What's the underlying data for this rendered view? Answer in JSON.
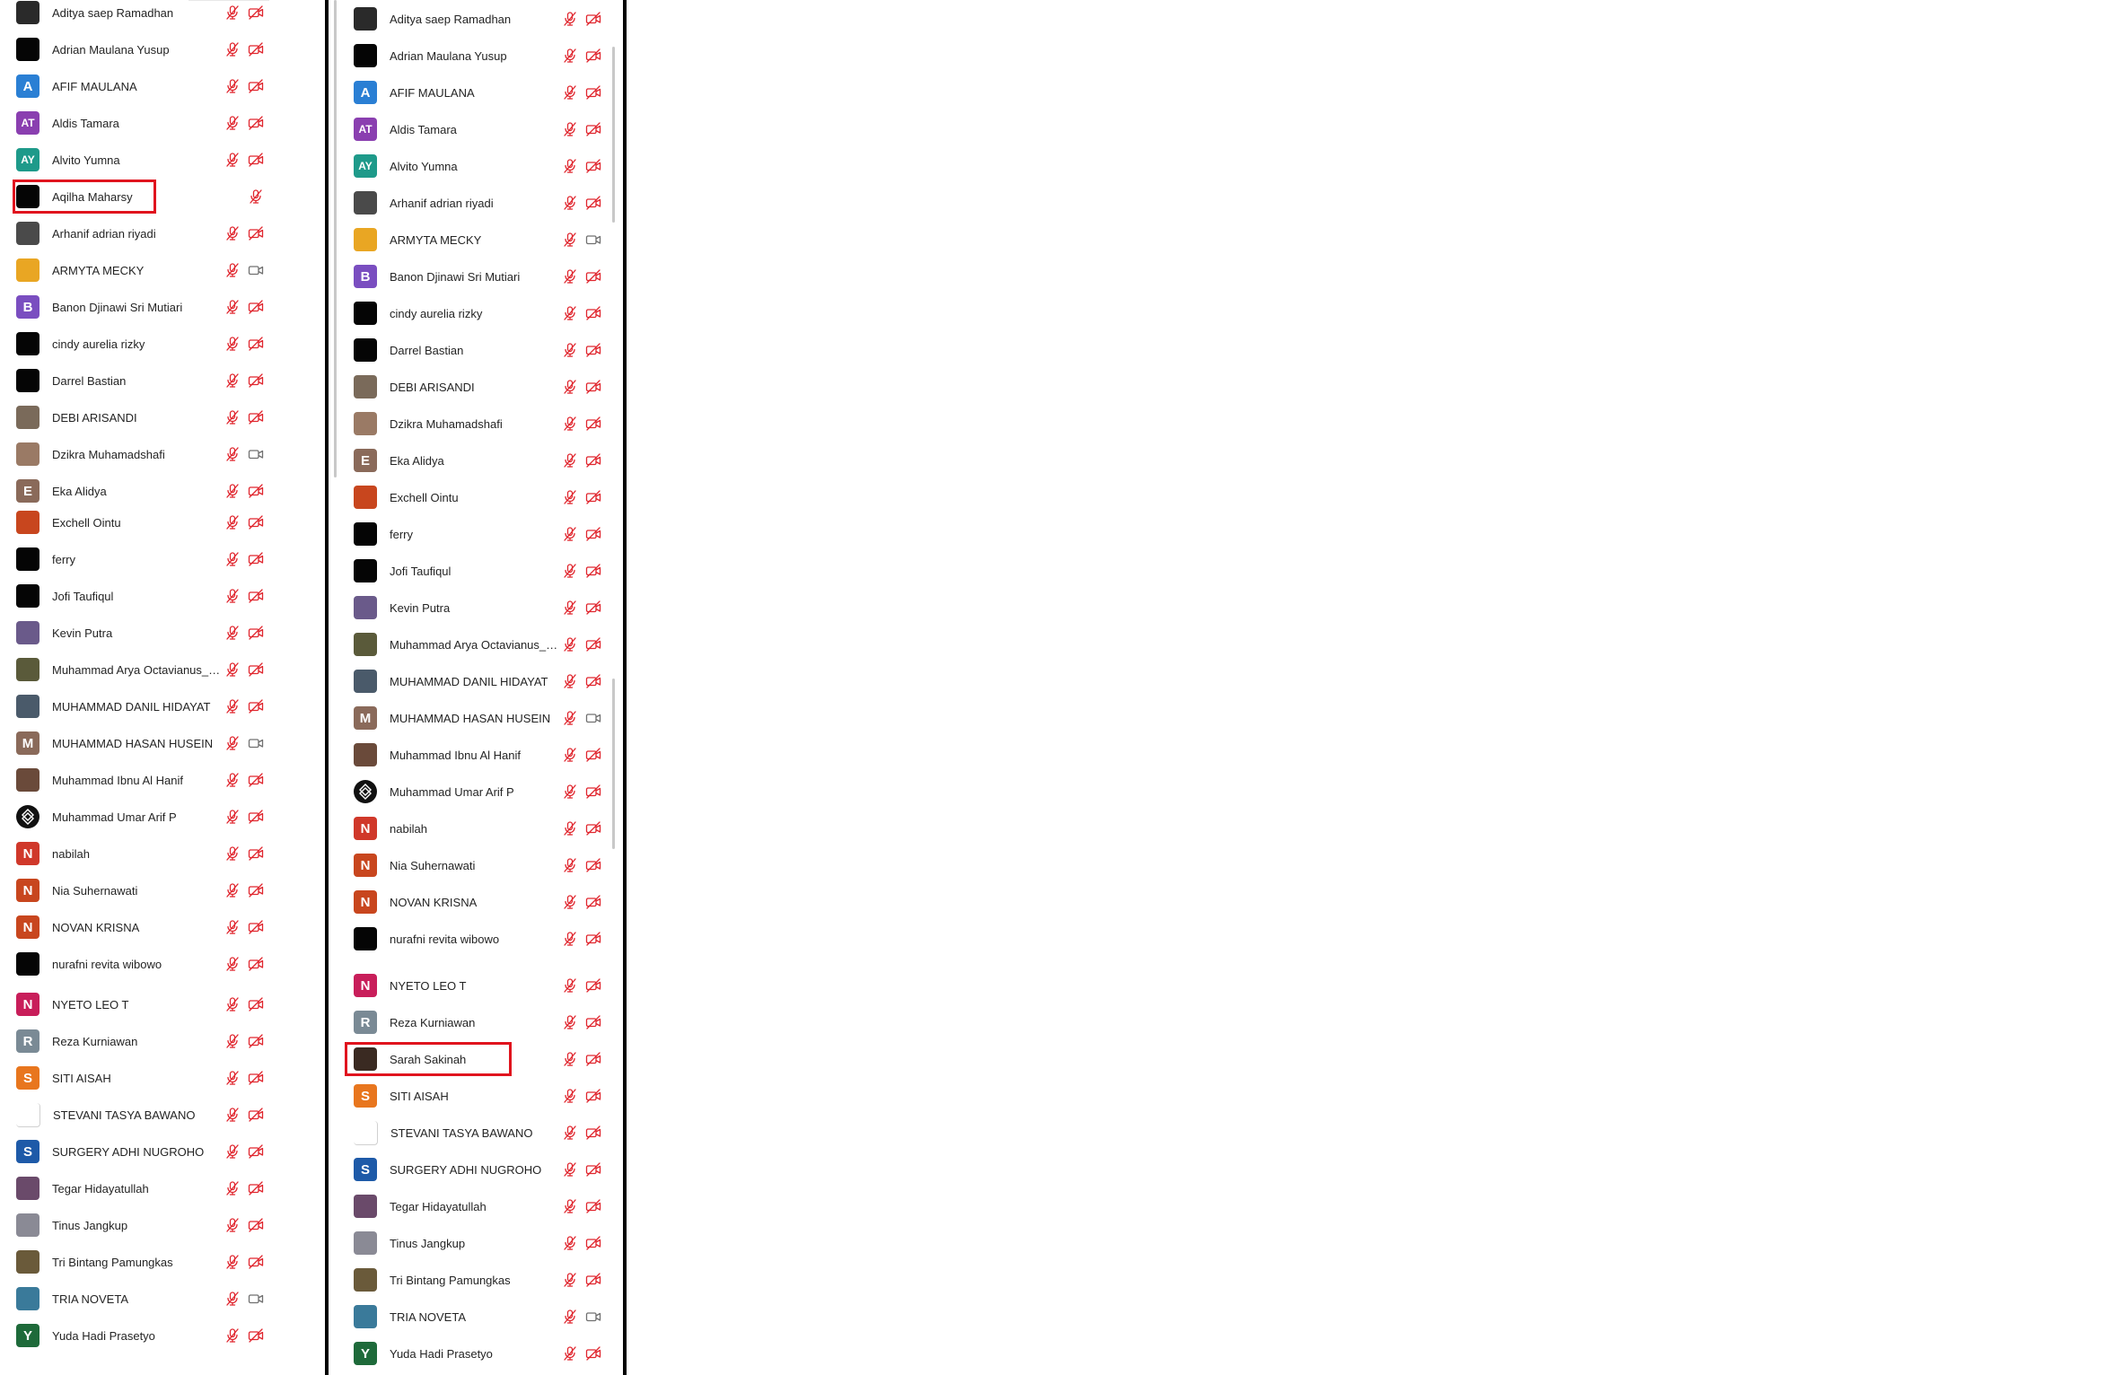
{
  "colors": {
    "muted_icon": "#e0262e",
    "video_icon": "#707070",
    "highlight": "#e0141e"
  },
  "left_panel": {
    "participants": [
      {
        "name": "Aditya saep Ramadhan",
        "avatar": {
          "type": "photo",
          "color": "#2a2a2a"
        },
        "mic": "mic-muted-icon",
        "video": "video-off-icon"
      },
      {
        "name": "Adrian Maulana Yusup",
        "avatar": {
          "type": "photo",
          "color": "#050505"
        },
        "mic": "mic-muted-icon",
        "video": "video-off-icon"
      },
      {
        "name": "AFIF MAULANA",
        "avatar": {
          "type": "initials",
          "initials": "A",
          "color": "#2a7fd4"
        },
        "mic": "mic-muted-icon",
        "video": "video-off-icon"
      },
      {
        "name": "Aldis Tamara",
        "avatar": {
          "type": "initials",
          "initials": "AT",
          "color": "#8a3fb0"
        },
        "mic": "mic-muted-icon",
        "video": "video-off-icon"
      },
      {
        "name": "Alvito Yumna",
        "avatar": {
          "type": "initials",
          "initials": "AY",
          "color": "#1e9a8a"
        },
        "mic": "mic-muted-icon",
        "video": "video-off-icon"
      },
      {
        "name": "Aqilha Maharsy",
        "avatar": {
          "type": "photo",
          "color": "#050505"
        },
        "mic": "mic-muted-icon",
        "video": "",
        "highlighted": true
      },
      {
        "name": "Arhanif adrian riyadi",
        "avatar": {
          "type": "photo",
          "color": "#4a4a4a"
        },
        "mic": "mic-muted-icon",
        "video": "video-off-icon"
      },
      {
        "name": "ARMYTA MECKY",
        "avatar": {
          "type": "photo",
          "color": "#e9a623"
        },
        "mic": "mic-muted-icon",
        "video": "video-on-icon"
      },
      {
        "name": "Banon Djinawi Sri Mutiari",
        "avatar": {
          "type": "initials",
          "initials": "B",
          "color": "#7a4ec0"
        },
        "mic": "mic-muted-icon",
        "video": "video-off-icon"
      },
      {
        "name": "cindy aurelia rizky",
        "avatar": {
          "type": "photo",
          "color": "#050505"
        },
        "mic": "mic-muted-icon",
        "video": "video-off-icon"
      },
      {
        "name": "Darrel Bastian",
        "avatar": {
          "type": "photo",
          "color": "#050505"
        },
        "mic": "mic-muted-icon",
        "video": "video-off-icon"
      },
      {
        "name": "DEBI ARISANDI",
        "avatar": {
          "type": "photo",
          "color": "#7a6a5a"
        },
        "mic": "mic-muted-icon",
        "video": "video-off-icon"
      },
      {
        "name": "Dzikra Muhamadshafi",
        "avatar": {
          "type": "photo",
          "color": "#9a7a65"
        },
        "mic": "mic-muted-icon",
        "video": "video-on-icon"
      },
      {
        "name": "Eka Alidya",
        "avatar": {
          "type": "initials",
          "initials": "E",
          "color": "#8a6a5a"
        },
        "mic": "mic-muted-icon",
        "video": "video-off-icon"
      },
      {
        "name": "Exchell Ointu",
        "avatar": {
          "type": "photo",
          "color": "#c8461e"
        },
        "mic": "mic-muted-icon",
        "video": "video-off-icon"
      },
      {
        "name": "ferry",
        "avatar": {
          "type": "photo",
          "color": "#050505"
        },
        "mic": "mic-muted-icon",
        "video": "video-off-icon"
      },
      {
        "name": "Jofi Taufiqul",
        "avatar": {
          "type": "photo",
          "color": "#050505"
        },
        "mic": "mic-muted-icon",
        "video": "video-off-icon"
      },
      {
        "name": "Kevin Putra",
        "avatar": {
          "type": "photo",
          "color": "#6a5a8a"
        },
        "mic": "mic-muted-icon",
        "video": "video-off-icon"
      },
      {
        "name": "Muhammad Arya Octavianus_J...",
        "avatar": {
          "type": "photo",
          "color": "#5a5a3a"
        },
        "mic": "mic-muted-icon",
        "video": "video-off-icon"
      },
      {
        "name": "MUHAMMAD DANIL HIDAYAT",
        "avatar": {
          "type": "photo",
          "color": "#4a5a6a"
        },
        "mic": "mic-muted-icon",
        "video": "video-off-icon"
      },
      {
        "name": "MUHAMMAD HASAN HUSEIN",
        "avatar": {
          "type": "initials",
          "initials": "M",
          "color": "#8a6a5a"
        },
        "mic": "mic-muted-icon",
        "video": "video-on-icon"
      },
      {
        "name": "Muhammad Ibnu Al Hanif",
        "avatar": {
          "type": "photo",
          "color": "#6a4a3a"
        },
        "mic": "mic-muted-icon",
        "video": "video-off-icon"
      },
      {
        "name": "Muhammad Umar Arif P",
        "avatar": {
          "type": "logo",
          "color": "#111111"
        },
        "mic": "mic-muted-icon",
        "video": "video-off-icon"
      },
      {
        "name": "nabilah",
        "avatar": {
          "type": "initials",
          "initials": "N",
          "color": "#d0382a"
        },
        "mic": "mic-muted-icon",
        "video": "video-off-icon"
      },
      {
        "name": "Nia Suhernawati",
        "avatar": {
          "type": "initials",
          "initials": "N",
          "color": "#c8461e"
        },
        "mic": "mic-muted-icon",
        "video": "video-off-icon"
      },
      {
        "name": "NOVAN KRISNA",
        "avatar": {
          "type": "initials",
          "initials": "N",
          "color": "#c8461e"
        },
        "mic": "mic-muted-icon",
        "video": "video-off-icon"
      },
      {
        "name": "nurafni revita wibowo",
        "avatar": {
          "type": "photo",
          "color": "#050505"
        },
        "mic": "mic-muted-icon",
        "video": "video-off-icon"
      },
      {
        "name": "NYETO LEO T",
        "avatar": {
          "type": "initials",
          "initials": "N",
          "color": "#c81e5a"
        },
        "mic": "mic-muted-icon",
        "video": "video-off-icon"
      },
      {
        "name": "Reza Kurniawan",
        "avatar": {
          "type": "initials",
          "initials": "R",
          "color": "#7a8a95"
        },
        "mic": "mic-muted-icon",
        "video": "video-off-icon"
      },
      {
        "name": "SITI AISAH",
        "avatar": {
          "type": "initials",
          "initials": "S",
          "color": "#e8761e"
        },
        "mic": "mic-muted-icon",
        "video": "video-off-icon"
      },
      {
        "name": "STEVANI TASYA BAWANO",
        "avatar": {
          "type": "blank",
          "color": "#ffffff"
        },
        "mic": "mic-muted-icon",
        "video": "video-off-icon"
      },
      {
        "name": "SURGERY ADHI NUGROHO",
        "avatar": {
          "type": "initials",
          "initials": "S",
          "color": "#1e5aa8"
        },
        "mic": "mic-muted-icon",
        "video": "video-off-icon"
      },
      {
        "name": "Tegar Hidayatullah",
        "avatar": {
          "type": "photo",
          "color": "#6a4a6a"
        },
        "mic": "mic-muted-icon",
        "video": "video-off-icon"
      },
      {
        "name": "Tinus Jangkup",
        "avatar": {
          "type": "photo",
          "color": "#8a8a95"
        },
        "mic": "mic-muted-icon",
        "video": "video-off-icon"
      },
      {
        "name": "Tri Bintang Pamungkas",
        "avatar": {
          "type": "photo",
          "color": "#6a5a3a"
        },
        "mic": "mic-muted-icon",
        "video": "video-off-icon"
      },
      {
        "name": "TRIA NOVETA",
        "avatar": {
          "type": "photo",
          "color": "#3a7a9a"
        },
        "mic": "mic-muted-icon",
        "video": "video-on-icon"
      },
      {
        "name": "Yuda Hadi Prasetyo",
        "avatar": {
          "type": "initials",
          "initials": "Y",
          "color": "#1e6a3a"
        },
        "mic": "mic-muted-icon",
        "video": "video-off-icon"
      }
    ]
  },
  "right_panel": {
    "participants": [
      {
        "name": "Aditya saep Ramadhan",
        "avatar": {
          "type": "photo",
          "color": "#2a2a2a"
        },
        "mic": "mic-muted-icon",
        "video": "video-off-icon"
      },
      {
        "name": "Adrian Maulana Yusup",
        "avatar": {
          "type": "photo",
          "color": "#050505"
        },
        "mic": "mic-muted-icon",
        "video": "video-off-icon"
      },
      {
        "name": "AFIF MAULANA",
        "avatar": {
          "type": "initials",
          "initials": "A",
          "color": "#2a7fd4"
        },
        "mic": "mic-muted-icon",
        "video": "video-off-icon"
      },
      {
        "name": "Aldis Tamara",
        "avatar": {
          "type": "initials",
          "initials": "AT",
          "color": "#8a3fb0"
        },
        "mic": "mic-muted-icon",
        "video": "video-off-icon"
      },
      {
        "name": "Alvito Yumna",
        "avatar": {
          "type": "initials",
          "initials": "AY",
          "color": "#1e9a8a"
        },
        "mic": "mic-muted-icon",
        "video": "video-off-icon"
      },
      {
        "name": "Arhanif adrian riyadi",
        "avatar": {
          "type": "photo",
          "color": "#4a4a4a"
        },
        "mic": "mic-muted-icon",
        "video": "video-off-icon"
      },
      {
        "name": "ARMYTA MECKY",
        "avatar": {
          "type": "photo",
          "color": "#e9a623"
        },
        "mic": "mic-muted-icon",
        "video": "video-on-icon"
      },
      {
        "name": "Banon Djinawi Sri Mutiari",
        "avatar": {
          "type": "initials",
          "initials": "B",
          "color": "#7a4ec0"
        },
        "mic": "mic-muted-icon",
        "video": "video-off-icon"
      },
      {
        "name": "cindy aurelia rizky",
        "avatar": {
          "type": "photo",
          "color": "#050505"
        },
        "mic": "mic-muted-icon",
        "video": "video-off-icon"
      },
      {
        "name": "Darrel Bastian",
        "avatar": {
          "type": "photo",
          "color": "#050505"
        },
        "mic": "mic-muted-icon",
        "video": "video-off-icon"
      },
      {
        "name": "DEBI ARISANDI",
        "avatar": {
          "type": "photo",
          "color": "#7a6a5a"
        },
        "mic": "mic-muted-icon",
        "video": "video-off-icon"
      },
      {
        "name": "Dzikra Muhamadshafi",
        "avatar": {
          "type": "photo",
          "color": "#9a7a65"
        },
        "mic": "mic-muted-icon",
        "video": "video-off-icon"
      },
      {
        "name": "Eka Alidya",
        "avatar": {
          "type": "initials",
          "initials": "E",
          "color": "#8a6a5a"
        },
        "mic": "mic-muted-icon",
        "video": "video-off-icon"
      },
      {
        "name": "Exchell Ointu",
        "avatar": {
          "type": "photo",
          "color": "#c8461e"
        },
        "mic": "mic-muted-icon",
        "video": "video-off-icon"
      },
      {
        "name": "ferry",
        "avatar": {
          "type": "photo",
          "color": "#050505"
        },
        "mic": "mic-muted-icon",
        "video": "video-off-icon"
      },
      {
        "name": "Jofi Taufiqul",
        "avatar": {
          "type": "photo",
          "color": "#050505"
        },
        "mic": "mic-muted-icon",
        "video": "video-off-icon"
      },
      {
        "name": "Kevin Putra",
        "avatar": {
          "type": "photo",
          "color": "#6a5a8a"
        },
        "mic": "mic-muted-icon",
        "video": "video-off-icon"
      },
      {
        "name": "Muhammad Arya Octavianus_J...",
        "avatar": {
          "type": "photo",
          "color": "#5a5a3a"
        },
        "mic": "mic-muted-icon",
        "video": "video-off-icon"
      },
      {
        "name": "MUHAMMAD DANIL HIDAYAT",
        "avatar": {
          "type": "photo",
          "color": "#4a5a6a"
        },
        "mic": "mic-muted-icon",
        "video": "video-off-icon"
      },
      {
        "name": "MUHAMMAD HASAN HUSEIN",
        "avatar": {
          "type": "initials",
          "initials": "M",
          "color": "#8a6a5a"
        },
        "mic": "mic-muted-icon",
        "video": "video-on-icon"
      },
      {
        "name": "Muhammad Ibnu Al Hanif",
        "avatar": {
          "type": "photo",
          "color": "#6a4a3a"
        },
        "mic": "mic-muted-icon",
        "video": "video-off-icon"
      },
      {
        "name": "Muhammad Umar Arif P",
        "avatar": {
          "type": "logo",
          "color": "#111111"
        },
        "mic": "mic-muted-icon",
        "video": "video-off-icon"
      },
      {
        "name": "nabilah",
        "avatar": {
          "type": "initials",
          "initials": "N",
          "color": "#d0382a"
        },
        "mic": "mic-muted-icon",
        "video": "video-off-icon"
      },
      {
        "name": "Nia Suhernawati",
        "avatar": {
          "type": "initials",
          "initials": "N",
          "color": "#c8461e"
        },
        "mic": "mic-muted-icon",
        "video": "video-off-icon"
      },
      {
        "name": "NOVAN KRISNA",
        "avatar": {
          "type": "initials",
          "initials": "N",
          "color": "#c8461e"
        },
        "mic": "mic-muted-icon",
        "video": "video-off-icon"
      },
      {
        "name": "nurafni revita wibowo",
        "avatar": {
          "type": "photo",
          "color": "#050505"
        },
        "mic": "mic-muted-icon",
        "video": "video-off-icon"
      },
      {
        "name": "NYETO LEO T",
        "avatar": {
          "type": "initials",
          "initials": "N",
          "color": "#c81e5a"
        },
        "mic": "mic-muted-icon",
        "video": "video-off-icon"
      },
      {
        "name": "Reza Kurniawan",
        "avatar": {
          "type": "initials",
          "initials": "R",
          "color": "#7a8a95"
        },
        "mic": "mic-muted-icon",
        "video": "video-off-icon"
      },
      {
        "name": "Sarah Sakinah",
        "avatar": {
          "type": "photo",
          "color": "#3a2a22"
        },
        "mic": "mic-muted-icon",
        "video": "video-off-icon",
        "highlighted": true
      },
      {
        "name": "SITI AISAH",
        "avatar": {
          "type": "initials",
          "initials": "S",
          "color": "#e8761e"
        },
        "mic": "mic-muted-icon",
        "video": "video-off-icon"
      },
      {
        "name": "STEVANI TASYA BAWANO",
        "avatar": {
          "type": "blank",
          "color": "#ffffff"
        },
        "mic": "mic-muted-icon",
        "video": "video-off-icon"
      },
      {
        "name": "SURGERY ADHI NUGROHO",
        "avatar": {
          "type": "initials",
          "initials": "S",
          "color": "#1e5aa8"
        },
        "mic": "mic-muted-icon",
        "video": "video-off-icon"
      },
      {
        "name": "Tegar Hidayatullah",
        "avatar": {
          "type": "photo",
          "color": "#6a4a6a"
        },
        "mic": "mic-muted-icon",
        "video": "video-off-icon"
      },
      {
        "name": "Tinus Jangkup",
        "avatar": {
          "type": "photo",
          "color": "#8a8a95"
        },
        "mic": "mic-muted-icon",
        "video": "video-off-icon"
      },
      {
        "name": "Tri Bintang Pamungkas",
        "avatar": {
          "type": "photo",
          "color": "#6a5a3a"
        },
        "mic": "mic-muted-icon",
        "video": "video-off-icon"
      },
      {
        "name": "TRIA NOVETA",
        "avatar": {
          "type": "photo",
          "color": "#3a7a9a"
        },
        "mic": "mic-muted-icon",
        "video": "video-on-icon"
      },
      {
        "name": "Yuda Hadi Prasetyo",
        "avatar": {
          "type": "initials",
          "initials": "Y",
          "color": "#1e6a3a"
        },
        "mic": "mic-muted-icon",
        "video": "video-off-icon"
      }
    ]
  }
}
